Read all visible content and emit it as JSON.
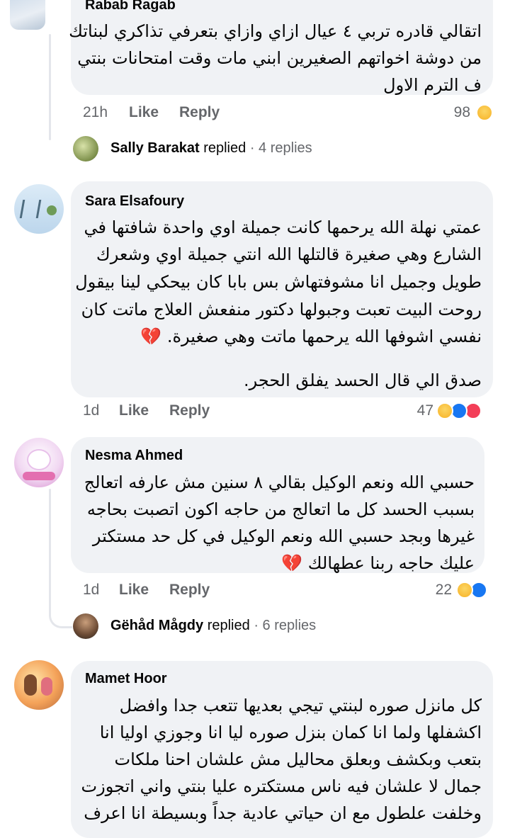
{
  "comments": [
    {
      "author": "Rabab Ragab",
      "lines": [
        "اتقالي قادره تربي ٤ عيال ازاي وازاي بتعرفي تذاكري لبناتك",
        "من دوشة اخواتهم الصغيرين ابني مات وقت امتحانات بنتي",
        "ف الترم الاول"
      ],
      "time": "21h",
      "like": "Like",
      "reply": "Reply",
      "reactions_count": "98",
      "reactions": [
        "sad"
      ]
    },
    {
      "author": "Sara Elsafoury",
      "lines": [
        "عمتي نهلة الله يرحمها كانت جميلة اوي واحدة شافتها في",
        "الشارع وهي صغيرة قالتلها الله انتي جميلة اوي وشعرك",
        "طويل وجميل انا مشوفتهاش بس بابا كان بيحكي لينا بيقول",
        "روحت البيت تعبت وجبولها دكتور منفعش العلاج ماتت كان",
        "نفسي اشوفها الله يرحمها ماتت وهي صغيرة. 💔",
        "",
        "صدق الي قال الحسد يفلق الحجر."
      ],
      "time": "1d",
      "like": "Like",
      "reply": "Reply",
      "reactions_count": "47",
      "reactions": [
        "sad",
        "like",
        "love"
      ]
    },
    {
      "author": "Nesma Ahmed",
      "lines": [
        "حسبي الله ونعم الوكيل بقالي ٨ سنين مش عارفه اتعالج",
        "بسبب الحسد كل ما اتعالج من حاجه اكون اتصبت بحاجه",
        "غيرها وبجد حسبي الله ونعم الوكيل في كل حد مستكتر",
        "عليك حاجه ربنا عطهالك 💔"
      ],
      "time": "1d",
      "like": "Like",
      "reply": "Reply",
      "reactions_count": "22",
      "reactions": [
        "sad",
        "like"
      ]
    },
    {
      "author": "Mamet Hoor",
      "lines": [
        "كل مانزل صوره لبنتي تيجي بعديها تتعب جدا وافضل",
        "اكشفلها   ولما انا كمان بنزل صوره ليا انا وجوزي اوليا انا",
        "بتعب وبكشف وبعلق محاليل مش علشان احنا ملكات",
        "جمال لا علشان فيه ناس مستكتره عليا بنتي واني اتجوزت",
        "وخلفت علطول  مع ان حياتي عادية جداً وبسيطة انا اعرف"
      ]
    }
  ],
  "reply_rows": [
    {
      "name": "Sally Barakat",
      "verb": "replied",
      "separator": "·",
      "count": "4 replies"
    },
    {
      "name": "Gëhåd Mågdy",
      "verb": "replied",
      "separator": "·",
      "count": "6 replies"
    }
  ],
  "colors": {
    "bubble": "#f0f2f5",
    "secondary_text": "#65676b",
    "like_blue": "#1877f2",
    "love_red": "#f33e58",
    "sad_yellow": "#f7b125"
  }
}
